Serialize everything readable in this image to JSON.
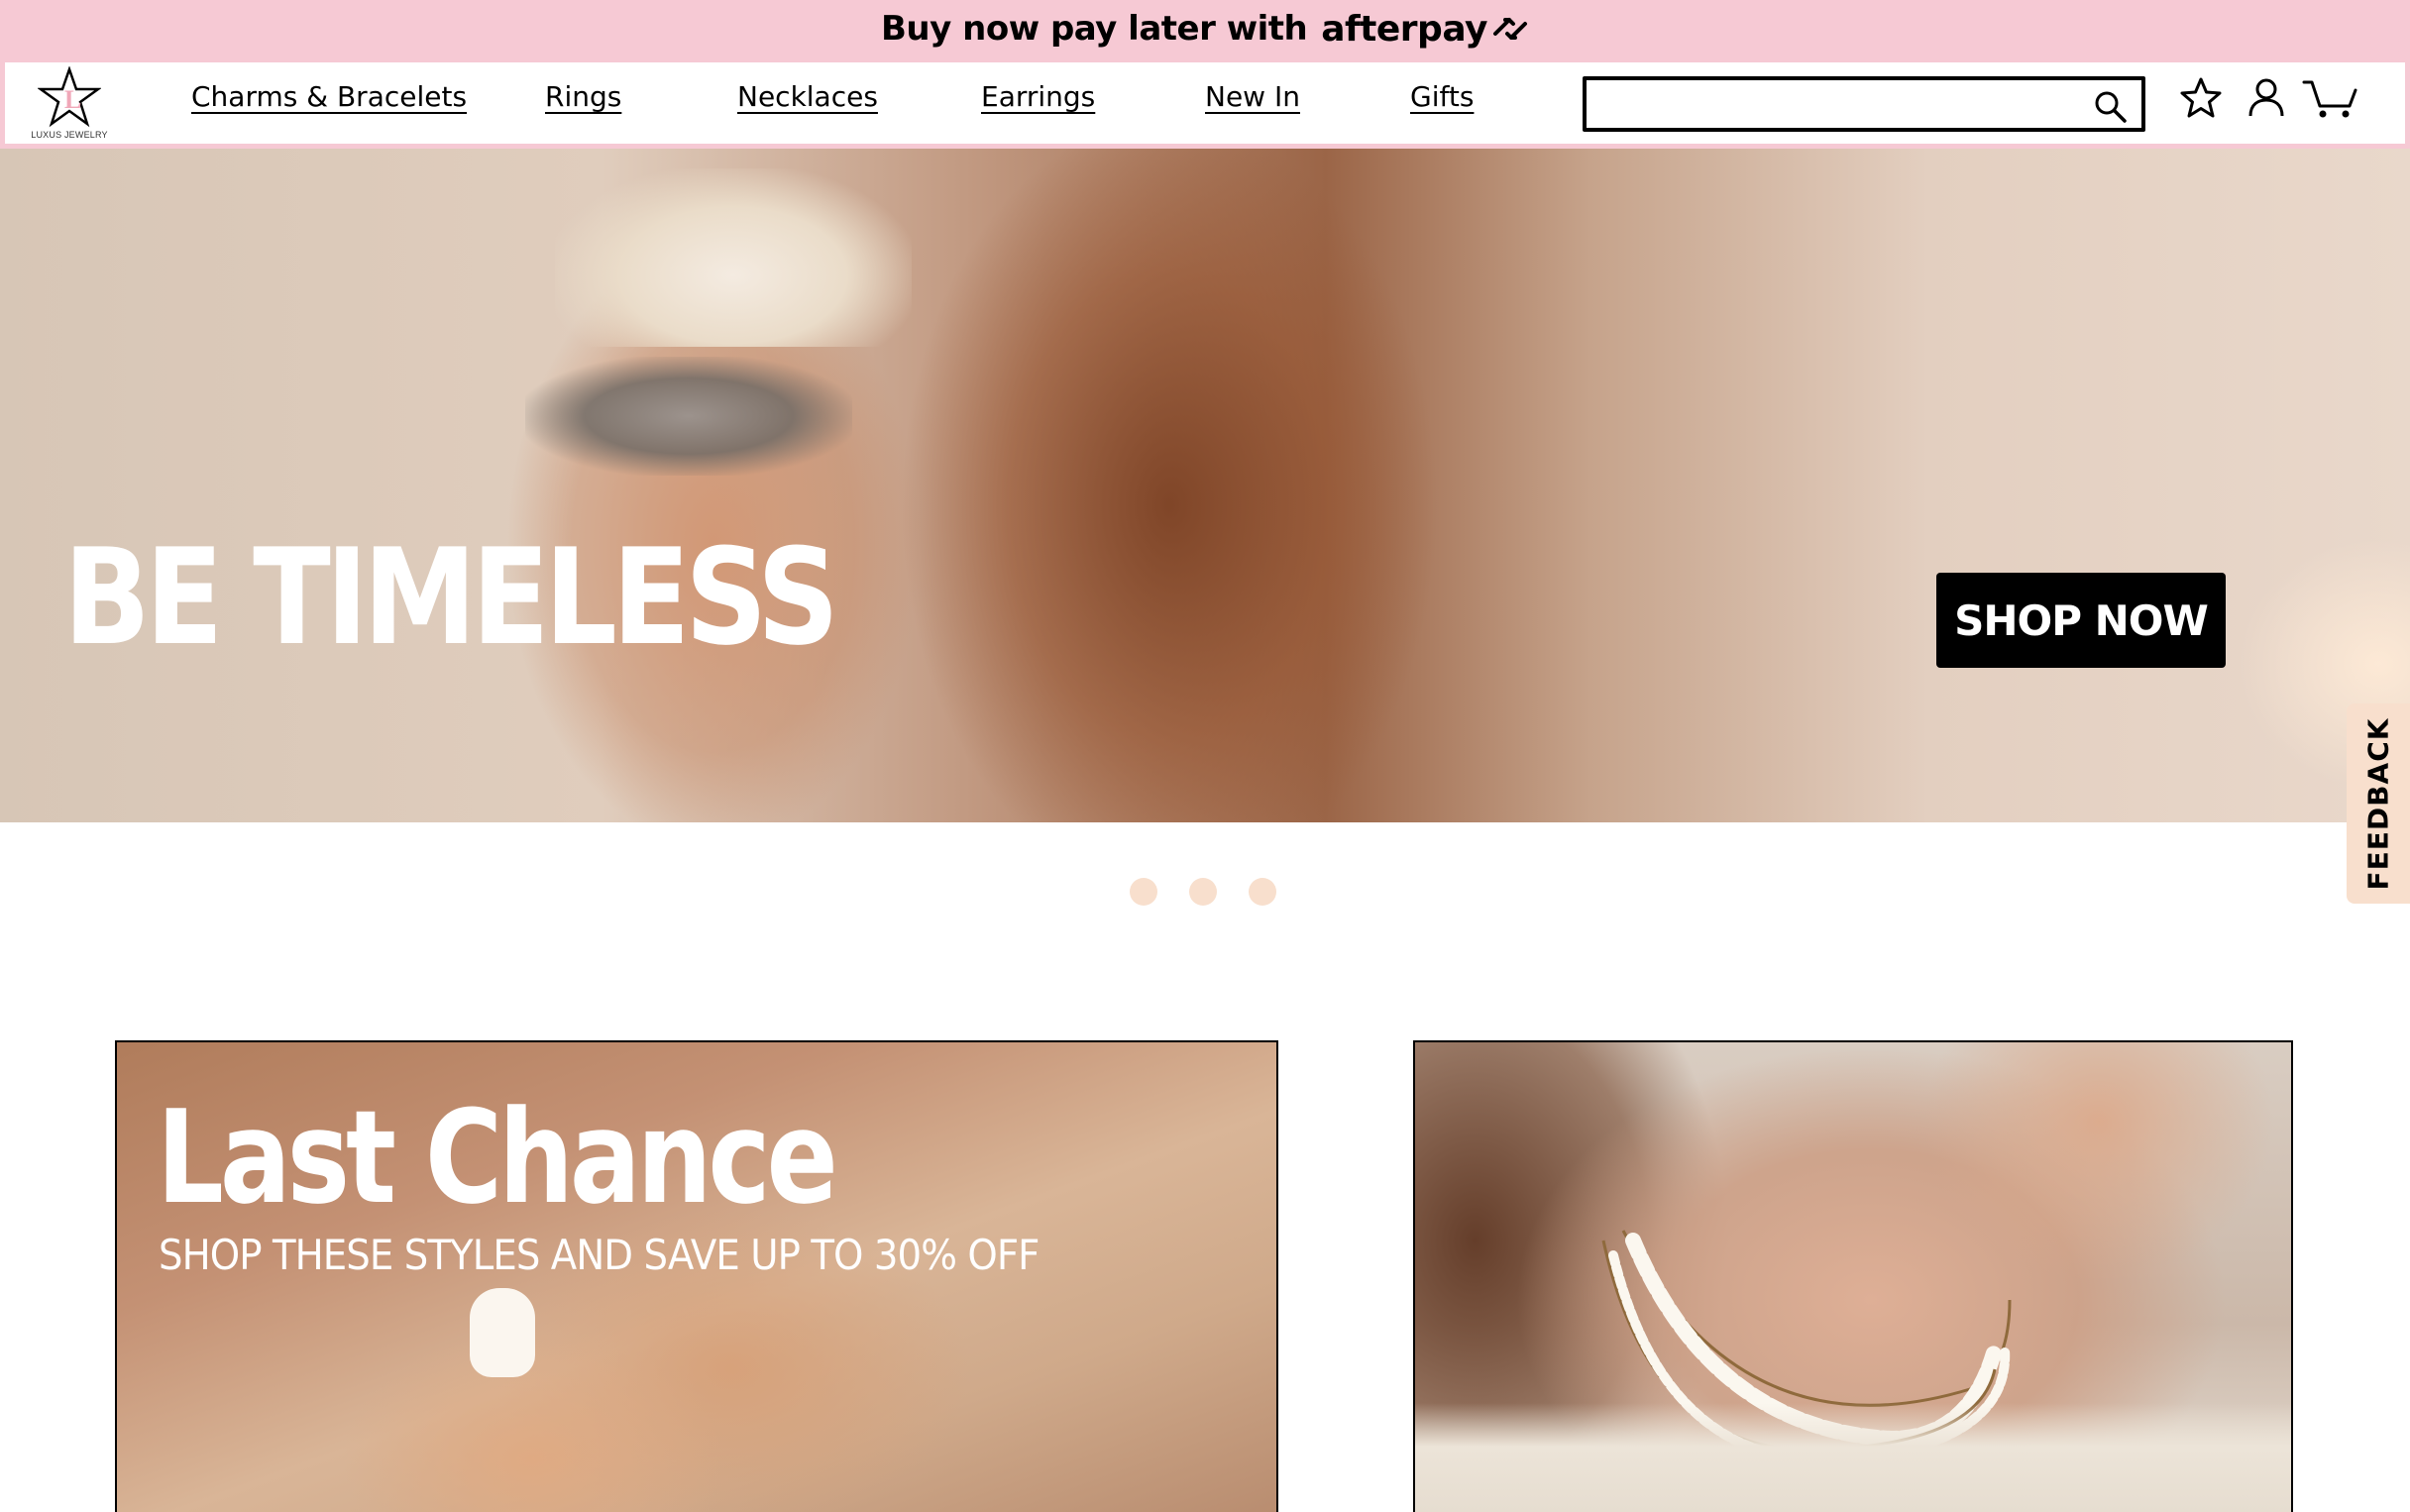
{
  "promo_bar": {
    "text": "Buy now pay later with",
    "brand": "afterpay"
  },
  "header": {
    "logo_text": "LUXUS JEWELRY",
    "nav": [
      {
        "label": "Charms & Bracelets"
      },
      {
        "label": "Rings"
      },
      {
        "label": "Necklaces"
      },
      {
        "label": "Earrings"
      },
      {
        "label": "New In"
      },
      {
        "label": "Gifts"
      }
    ],
    "search": {
      "value": "",
      "placeholder": ""
    },
    "icons": [
      "wishlist-star-icon",
      "account-icon",
      "cart-icon"
    ]
  },
  "hero": {
    "title": "BE TIMELESS",
    "cta": "SHOP NOW",
    "slides": 3
  },
  "feedback": {
    "label": "FEEDBACK"
  },
  "cards": {
    "left": {
      "title": "Last Chance",
      "subtitle": "SHOP THESE STYLES AND SAVE UP TO 30% OFF"
    }
  },
  "colors": {
    "promo_bg": "#f6c9d4",
    "header_border": "#f6c9d4",
    "dot": "#f8dfcd",
    "feedback_bg": "#f8dfcd",
    "cta_bg": "#000000"
  }
}
